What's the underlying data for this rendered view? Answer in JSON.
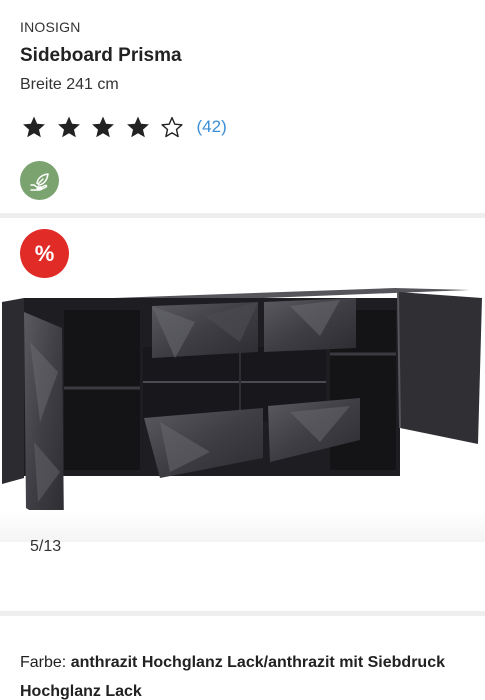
{
  "product": {
    "brand": "INOSIGN",
    "title": "Sideboard Prisma",
    "subtitle": "Breite 241 cm",
    "rating": {
      "value": 4,
      "max": 5,
      "count_label": "(42)"
    }
  },
  "badges": {
    "eco_icon": "leaf-hand-icon",
    "sale_label": "%"
  },
  "gallery": {
    "counter": "5/13",
    "current": 5,
    "total": 13
  },
  "attributes": {
    "color_label": "Farbe:",
    "color_value": "anthrazit Hochglanz Lack/anthrazit mit Siebdruck Hochglanz Lack"
  },
  "colors": {
    "accent_link": "#3b8fd6",
    "sale": "#e02b27",
    "eco": "#7aa36f",
    "divider": "#eeeeee"
  }
}
